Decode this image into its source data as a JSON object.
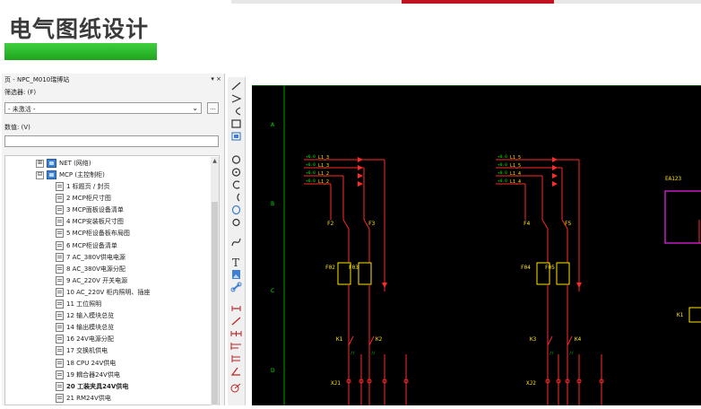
{
  "slide": {
    "title": "电气图纸设计"
  },
  "panel": {
    "title": "页 - NPC_M010瑞博站",
    "close": "▾ ×",
    "filter_label": "筛选器: (F)",
    "filter_value": "- 未激活 -",
    "filter_button": "...",
    "data_label": "数值: (V)",
    "data_value": "",
    "tree": {
      "net": {
        "toggle": "⊞",
        "label": "NET (网络)"
      },
      "mcp": {
        "toggle": "⊟",
        "label": "MCP (主控制柜)"
      },
      "pages": [
        {
          "label": "1 标题页 / 封页"
        },
        {
          "label": "2 MCP柜尺寸图"
        },
        {
          "label": "3 MCP面板设备清单"
        },
        {
          "label": "4 MCP安装板尺寸图"
        },
        {
          "label": "5 MCP柜设备板布局图"
        },
        {
          "label": "6 MCP柜设备清单"
        },
        {
          "label": "7 AC_380V供电电源"
        },
        {
          "label": "8 AC_380V电源分配"
        },
        {
          "label": "9 AC_220V 开关电源"
        },
        {
          "label": "10 AC_220V 柜内照明、插座"
        },
        {
          "label": "11 工位照明"
        },
        {
          "label": "12 输入模块总览"
        },
        {
          "label": "14 输出模块总览"
        },
        {
          "label": "16 24V电源分配"
        },
        {
          "label": "17 交换机供电"
        },
        {
          "label": "18 CPU 24V供电"
        },
        {
          "label": "19 耦合器24V供电"
        },
        {
          "label": "20 工装夹具24V供电"
        },
        {
          "label": "21 RM24V供电"
        }
      ]
    }
  },
  "schematic": {
    "row_labels": [
      "A",
      "B",
      "C",
      "D"
    ],
    "inputs_left": [
      "L1_3",
      "L1_3",
      "L1_2",
      "L1_2"
    ],
    "inputs_right": [
      "L1_5",
      "L1_5",
      "L1_4",
      "L1_4"
    ],
    "breakers": [
      "F2",
      "F3",
      "F4",
      "F5"
    ],
    "fuses": [
      "F02",
      "F03",
      "F04",
      "F05"
    ],
    "contactors": [
      "K1",
      "K2",
      "K3",
      "K4"
    ],
    "terminals": [
      "XJ1",
      "XJ2"
    ],
    "box_label": "EA123",
    "right_relay": "K1",
    "colors": {
      "background": "#000000",
      "wire_red": "#ff2a2a",
      "wire_yellow": "#ffe600",
      "wire_green": "#00e600",
      "border_green": "#00a000",
      "box_magenta": "#c21ec2"
    }
  },
  "colors": {
    "title_text": "#3b3b3b",
    "green_bar": "#2dbb2d",
    "accent_red": "#c1121f"
  }
}
